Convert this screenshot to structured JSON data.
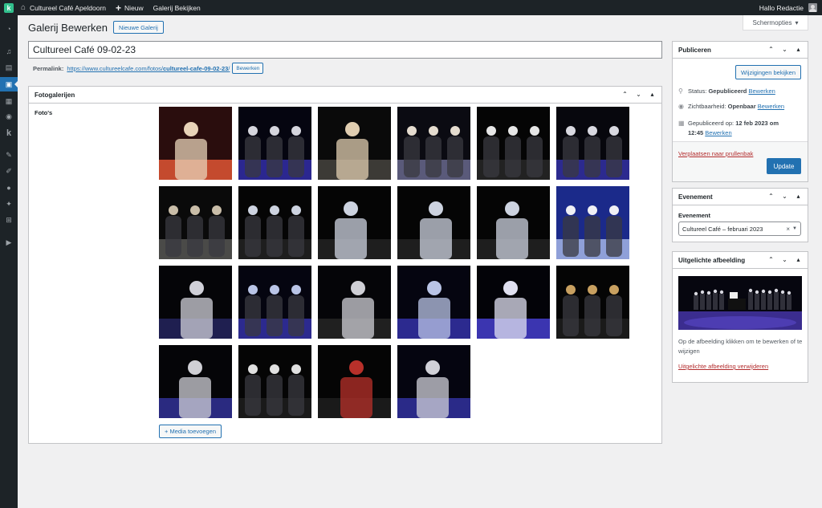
{
  "adminbar": {
    "site_name": "Cultureel Café Apeldoorn",
    "new_label": "Nieuw",
    "view_label": "Galerij Bekijken",
    "greeting": "Hallo Redactie"
  },
  "screen_options": {
    "label": "Schermopties"
  },
  "header": {
    "title": "Galerij Bewerken",
    "new_button": "Nieuwe Galerij"
  },
  "post": {
    "title": "Cultureel Café 09-02-23",
    "permalink_label": "Permalink:",
    "permalink_base": "https://www.cultureelcafe.com/fotos/",
    "permalink_slug": "cultureel-cafe-09-02-23",
    "permalink_end": "/",
    "permalink_edit": "Bewerken"
  },
  "gallery": {
    "title": "Fotogalerijen",
    "photos_label": "Foto's",
    "photo_count": 22,
    "add_media": "+ Media toevoegen"
  },
  "publish": {
    "title": "Publiceren",
    "review_button": "Wijzigingen bekijken",
    "status_label": "Status:",
    "status_value": "Gepubliceerd",
    "visibility_label": "Zichtbaarheid:",
    "visibility_value": "Openbaar",
    "published_label": "Gepubliceerd op:",
    "published_date": "12 feb 2023 om",
    "published_time": "12:45",
    "edit_link": "Bewerken",
    "trash_link": "Verplaatsen naar prullenbak",
    "update_button": "Update"
  },
  "event": {
    "title": "Evenement",
    "field_label": "Evenement",
    "selected": "Cultureel Café – februari 2023"
  },
  "featured": {
    "title": "Uitgelichte afbeelding",
    "help": "Op de afbeelding klikken om te bewerken of te wijzigen",
    "remove_link": "Uitgelichte afbeelding verwijderen"
  },
  "icons": {
    "logo": "k-logo-icon",
    "home": "home-icon",
    "plus": "plus-icon",
    "sort_up": "chevron-up-icon",
    "sort_down": "chevron-down-icon",
    "toggle": "triangle-up-icon",
    "pin": "pin-icon",
    "eye": "eye-icon",
    "calendar": "calendar-icon"
  }
}
